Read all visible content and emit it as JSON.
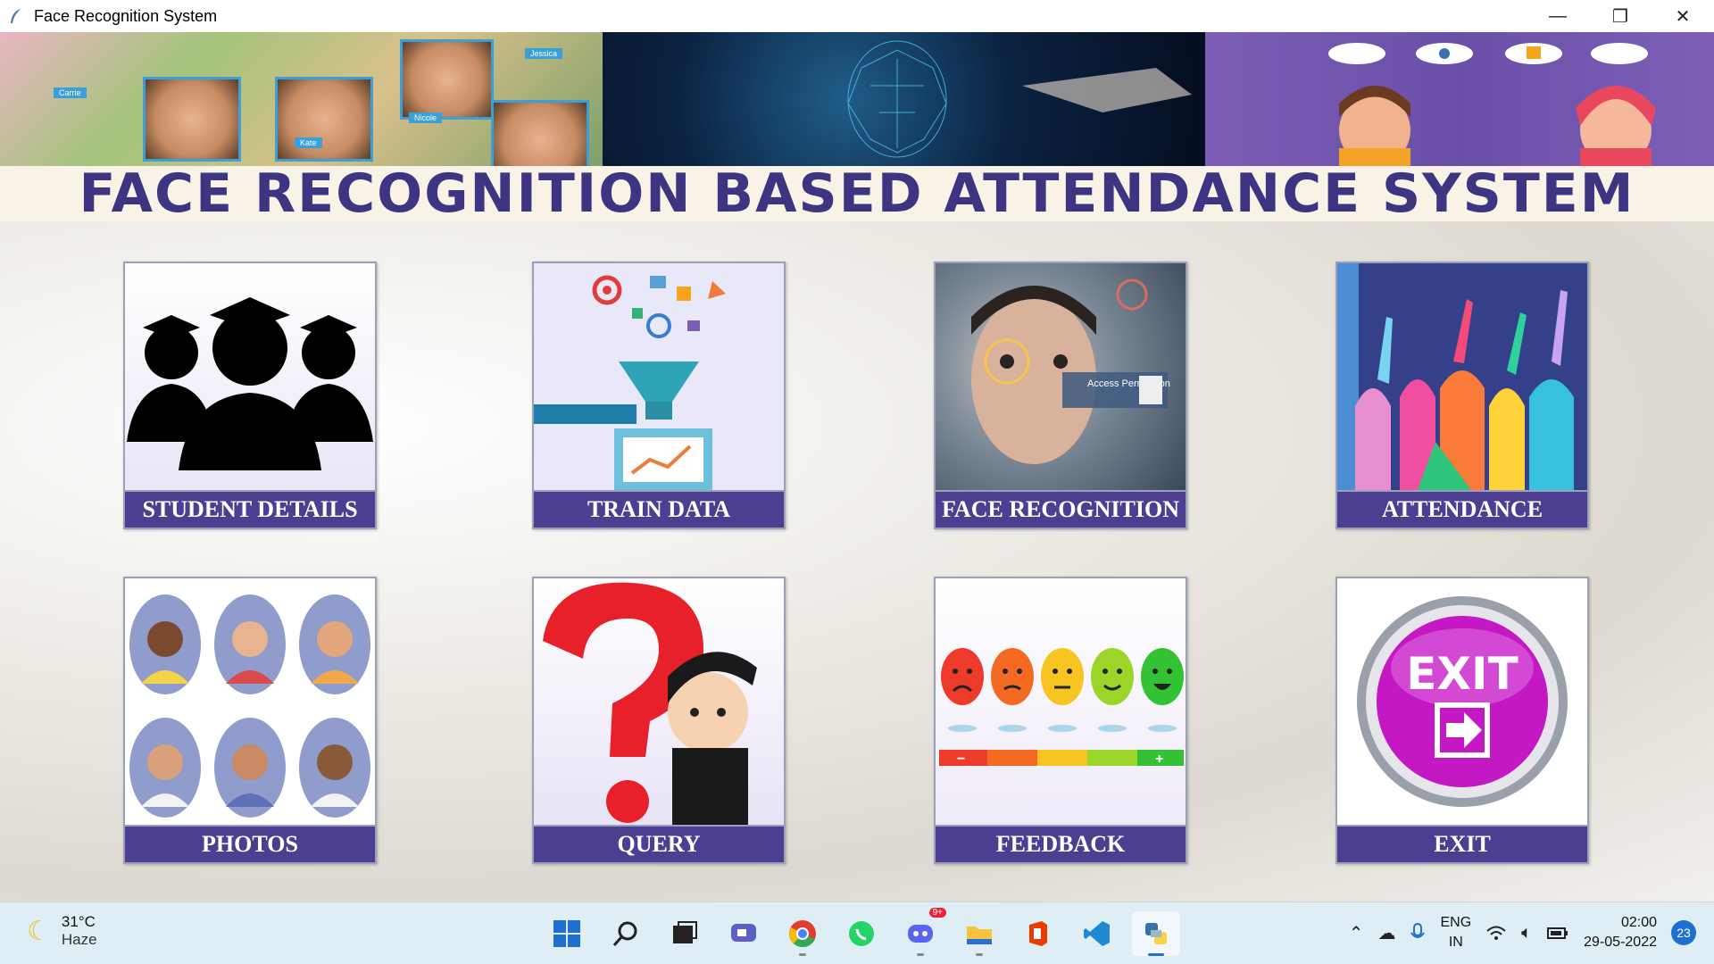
{
  "window": {
    "title": "Face Recognition System",
    "minimize_glyph": "—",
    "maximize_glyph": "❐",
    "close_glyph": "✕"
  },
  "banner": {
    "face_tags": [
      "Carrie",
      "Kate",
      "Nicole",
      "Jessica"
    ]
  },
  "heading": "FACE RECOGNITION BASED ATTENDANCE SYSTEM",
  "tiles": [
    {
      "label": "STUDENT DETAILS",
      "icon": "students-icon"
    },
    {
      "label": "TRAIN DATA",
      "icon": "funnel-icon"
    },
    {
      "label": "FACE RECOGNITION",
      "icon": "face-scan-icon"
    },
    {
      "label": "ATTENDANCE",
      "icon": "raised-hands-icon"
    },
    {
      "label": "PHOTOS",
      "icon": "avatars-icon"
    },
    {
      "label": "QUERY",
      "icon": "question-mark-icon"
    },
    {
      "label": "FEEDBACK",
      "icon": "emoji-scale-icon"
    },
    {
      "label": "EXIT",
      "icon": "exit-icon"
    }
  ],
  "face_card": {
    "text": "Access Permission"
  },
  "exit_button_text": "EXIT",
  "feedback_scale": {
    "minus": "−",
    "plus": "+"
  },
  "taskbar": {
    "weather_temp": "31°C",
    "weather_desc": "Haze",
    "language": "ENG",
    "region": "IN",
    "time": "02:00",
    "date": "29-05-2022",
    "notification_count": "23",
    "discord_badge": "9+"
  },
  "colors": {
    "accent_purple": "#4c3f92",
    "heading_text": "#3d3482",
    "taskbar_bg": "#dfeef4"
  }
}
